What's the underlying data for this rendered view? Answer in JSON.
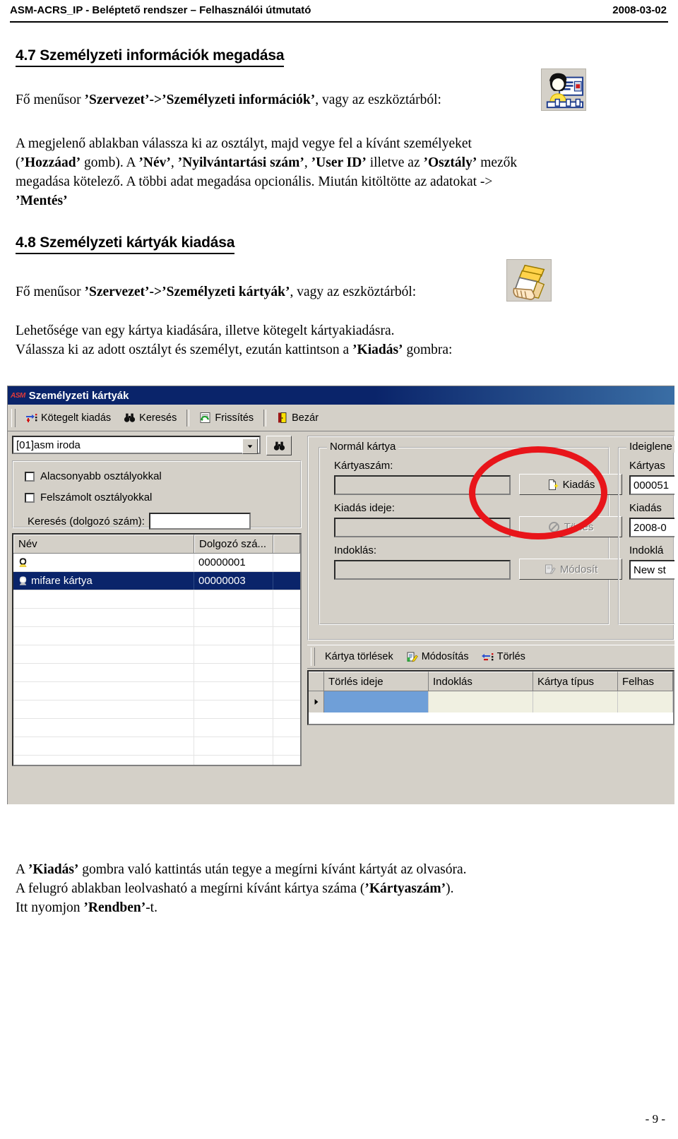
{
  "document": {
    "header_left": "ASM-ACRS_IP - Beléptető rendszer – Felhasználói útmutató",
    "header_date": "2008-03-02",
    "page_number": "- 9 -"
  },
  "sections": [
    {
      "id": "4.7",
      "heading": "4.7 Személyzeti információk megadása",
      "menu_line_prefix": "Fő menűsor ",
      "menu_path": "’Szervezet’->’Személyzeti információk’",
      "menu_line_suffix": ", vagy az eszköztárból:",
      "icon_name": "personnel-info-toolbar-icon",
      "body": "A megjelenő ablakban válassza ki az osztályt, majd vegye fel a kívánt személyeket (’Hozzáad’ gomb). A ’Név’, ’Nyilvántartási szám’, ’User ID’ illetve az ’Osztály’ mezők megadása kötelező. A többi adat megadása opcionális. Miután kitöltötte az adatokat -> ’Mentés’"
    },
    {
      "id": "4.8",
      "heading": "4.8 Személyzeti kártyák kiadása",
      "menu_line_prefix": "Fő menűsor ",
      "menu_path": "’Szervezet’->’Személyzeti kártyák’",
      "menu_line_suffix": ", vagy az eszköztárból:",
      "icon_name": "personnel-cards-toolbar-icon",
      "body": "Lehetősége van egy kártya kiadására, illetve kötegelt kártyakiadásra. Válassza ki az adott osztályt és személyt, ezután  kattintson a ’Kiadás’ gombra:"
    }
  ],
  "footnote": "A ’Kiadás’ gombra való kattintás után tegye a megírni kívánt kártyát az olvasóra. A felugró ablakban leolvasható a megírni kívánt kártya száma (’Kártyaszám’). Itt nyomjon ’Rendben’-t.",
  "app_window": {
    "title": "Személyzeti kártyák",
    "logo": "ASM",
    "toolbar": [
      {
        "label": "Kötegelt kiadás",
        "icon": "batch-issue-icon"
      },
      {
        "label": "Keresés",
        "icon": "binoculars-icon"
      },
      {
        "label": "Frissítés",
        "icon": "refresh-icon"
      },
      {
        "label": "Bezár",
        "icon": "exit-door-icon"
      }
    ],
    "department_select": {
      "value": "[01]asm iroda",
      "find_icon": "binoculars-icon"
    },
    "filters": {
      "checkbox_lower_departments": {
        "label": "Alacsonyabb osztályokkal",
        "checked": false
      },
      "checkbox_dissolved_departments": {
        "label": "Felszámolt osztályokkal",
        "checked": false
      },
      "search_label": "Keresés (dolgozó szám):",
      "search_value": ""
    },
    "person_grid": {
      "columns": [
        "Név",
        "Dolgozó szá...",
        ""
      ],
      "rows": [
        {
          "name": "",
          "number": "00000001",
          "selected": false,
          "icon": "person-icon"
        },
        {
          "name": "mifare kártya",
          "number": "00000003",
          "selected": true,
          "icon": "person-card-icon"
        }
      ]
    },
    "normal_card_group": {
      "title": "Normál kártya",
      "card_number_label": "Kártyaszám:",
      "card_number_value": "",
      "issue_time_label": "Kiadás ideje:",
      "issue_time_value": "",
      "reason_label": "Indoklás:",
      "reason_value": "",
      "buttons": [
        {
          "label": "Kiadás",
          "icon": "new-card-icon",
          "enabled": true,
          "highlighted": true
        },
        {
          "label": "Törlés",
          "icon": "no-entry-icon",
          "enabled": false
        },
        {
          "label": "Módosít",
          "icon": "edit-icon",
          "enabled": false
        }
      ]
    },
    "temporary_card_group": {
      "title": "Ideiglene",
      "card_number_label": "Kártyas",
      "card_number_value": "000051",
      "issue_time_label": "Kiadás",
      "issue_time_value": "2008-0",
      "reason_label": "Indoklá",
      "reason_value": "New st"
    },
    "deletions_toolbar": {
      "title": "Kártya törlések",
      "buttons": [
        {
          "label": "Módosítás",
          "icon": "edit-icon"
        },
        {
          "label": "Törlés",
          "icon": "delete-row-icon"
        }
      ]
    },
    "deletions_grid": {
      "columns": [
        "Törlés ideje",
        "Indoklás",
        "Kártya típus",
        "Felhas"
      ],
      "rows": [
        {
          "cells": [
            "",
            "",
            "",
            ""
          ],
          "current": true
        }
      ]
    },
    "annotation": {
      "shape": "ellipse",
      "color": "#e8151a",
      "targets": "Kiadás"
    }
  }
}
